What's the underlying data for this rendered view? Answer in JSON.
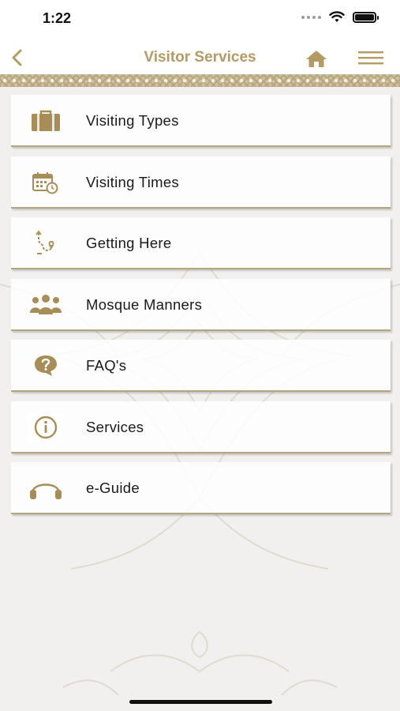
{
  "status_bar": {
    "time": "1:22"
  },
  "nav": {
    "title": "Visitor Services"
  },
  "menu": {
    "items": [
      {
        "label": "Visiting Types",
        "icon": "briefcase-icon"
      },
      {
        "label": "Visiting Times",
        "icon": "calendar-clock-icon"
      },
      {
        "label": "Getting Here",
        "icon": "route-icon"
      },
      {
        "label": "Mosque Manners",
        "icon": "people-group-icon"
      },
      {
        "label": "FAQ's",
        "icon": "question-bubble-icon"
      },
      {
        "label": "Services",
        "icon": "info-icon"
      },
      {
        "label": "e-Guide",
        "icon": "headphones-icon"
      }
    ]
  },
  "colors": {
    "accent": "#b49a63",
    "icon": "#a78d57",
    "background": "#f1f0ee"
  }
}
